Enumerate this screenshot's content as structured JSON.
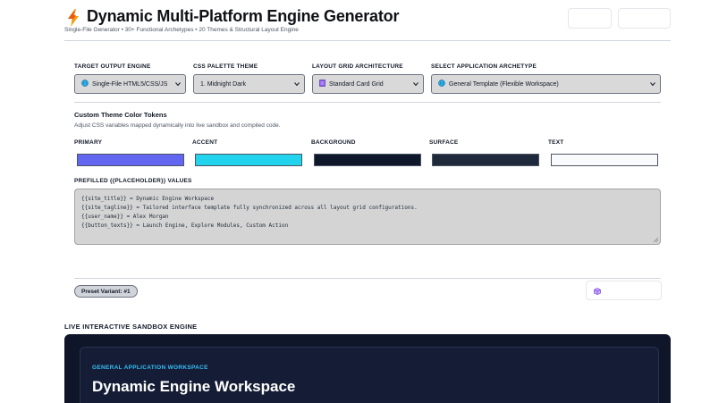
{
  "header": {
    "title": "Dynamic Multi-Platform Engine Generator",
    "subtitle": "Single-File Generator • 30+ Functional Archetypes • 20 Themes & Structural Layout Engine",
    "logo_icon": "lightning-bolt-icon"
  },
  "config": {
    "engine": {
      "label": "TARGET OUTPUT ENGINE",
      "value": "Single-File HTML5/CSS/JS",
      "icon": "globe-icon"
    },
    "palette": {
      "label": "CSS PALETTE THEME",
      "value": "1. Midnight Dark"
    },
    "grid": {
      "label": "LAYOUT GRID ARCHITECTURE",
      "value": "Standard Card Grid",
      "icon": "card-grid-icon"
    },
    "archetype": {
      "label": "SELECT APPLICATION ARCHETYPE",
      "value": "General Template (Flexible Workspace)",
      "icon": "globe-icon"
    }
  },
  "tokens": {
    "title": "Custom Theme Color Tokens",
    "description": "Adjust CSS variables mapped dynamically into live sandbox and compiled code.",
    "items": [
      {
        "label": "PRIMARY",
        "color": "#6366f1"
      },
      {
        "label": "ACCENT",
        "color": "#22d3ee"
      },
      {
        "label": "BACKGROUND",
        "color": "#0f172a"
      },
      {
        "label": "SURFACE",
        "color": "#1e293b"
      },
      {
        "label": "TEXT",
        "color": "#f8fafc"
      }
    ]
  },
  "placeholders": {
    "label": "PREFILLED {{PLACEHOLDER}} VALUES",
    "lines": [
      "{{site_title}} = Dynamic Engine Workspace",
      "{{site_tagline}} = Tailored interface template fully synchronized across all layout grid configurations.",
      "{{user_name}} = Alex Morgan",
      "{{button_texts}} = Launch Engine, Explore Modules, Custom Action"
    ]
  },
  "preset": {
    "label": "Preset Variant: #1"
  },
  "sandbox": {
    "label": "LIVE INTERACTIVE SANDBOX ENGINE",
    "eyebrow": "GENERAL APPLICATION WORKSPACE",
    "title": "Dynamic Engine Workspace"
  }
}
